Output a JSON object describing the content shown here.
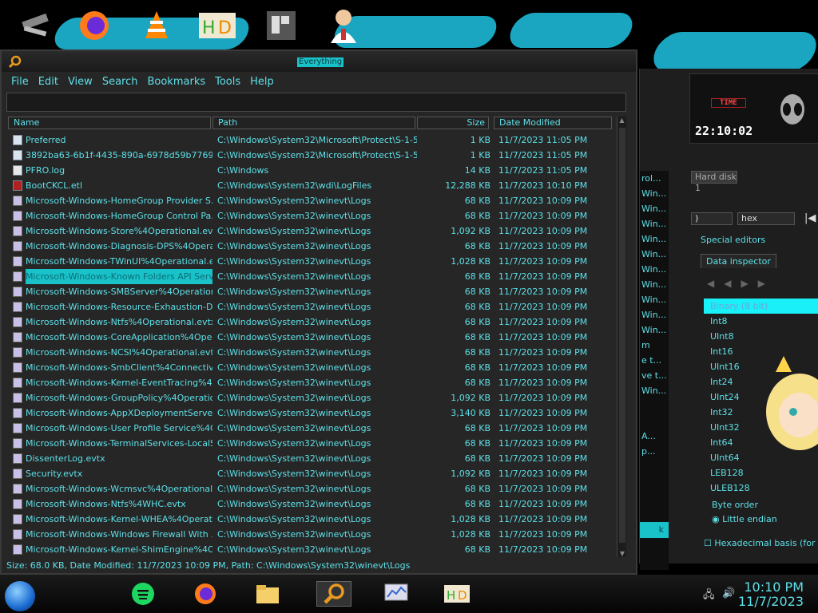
{
  "everything": {
    "title": "Everything",
    "menu": [
      "File",
      "Edit",
      "View",
      "Search",
      "Bookmarks",
      "Tools",
      "Help"
    ],
    "search_value": "",
    "columns": {
      "name": "Name",
      "path": "Path",
      "size": "Size",
      "date": "Date Modified"
    },
    "rows": [
      {
        "icon": "file",
        "name": "Preferred",
        "path": "C:\\Windows\\System32\\Microsoft\\Protect\\S-1-5-...",
        "size": "1 KB",
        "date": "11/7/2023 11:05 PM"
      },
      {
        "icon": "file",
        "name": "3892ba63-6b1f-4435-890a-6978d59b7769",
        "path": "C:\\Windows\\System32\\Microsoft\\Protect\\S-1-5-...",
        "size": "1 KB",
        "date": "11/7/2023 11:05 PM"
      },
      {
        "icon": "log",
        "name": "PFRO.log",
        "path": "C:\\Windows",
        "size": "14 KB",
        "date": "11/7/2023 11:05 PM"
      },
      {
        "icon": "etl",
        "name": "BootCKCL.etl",
        "path": "C:\\Windows\\System32\\wdi\\LogFiles",
        "size": "12,288 KB",
        "date": "11/7/2023 10:10 PM"
      },
      {
        "icon": "evtx",
        "name": "Microsoft-Windows-HomeGroup Provider S...",
        "path": "C:\\Windows\\System32\\winevt\\Logs",
        "size": "68 KB",
        "date": "11/7/2023 10:09 PM"
      },
      {
        "icon": "evtx",
        "name": "Microsoft-Windows-HomeGroup Control Pa...",
        "path": "C:\\Windows\\System32\\winevt\\Logs",
        "size": "68 KB",
        "date": "11/7/2023 10:09 PM"
      },
      {
        "icon": "evtx",
        "name": "Microsoft-Windows-Store%4Operational.evtx",
        "path": "C:\\Windows\\System32\\winevt\\Logs",
        "size": "1,092 KB",
        "date": "11/7/2023 10:09 PM"
      },
      {
        "icon": "evtx",
        "name": "Microsoft-Windows-Diagnosis-DPS%4Opera...",
        "path": "C:\\Windows\\System32\\winevt\\Logs",
        "size": "68 KB",
        "date": "11/7/2023 10:09 PM"
      },
      {
        "icon": "evtx",
        "name": "Microsoft-Windows-TWinUI%4Operational.e...",
        "path": "C:\\Windows\\System32\\winevt\\Logs",
        "size": "1,028 KB",
        "date": "11/7/2023 10:09 PM"
      },
      {
        "icon": "evtx",
        "name": "Microsoft-Windows-Known Folders API Serv...",
        "path": "C:\\Windows\\System32\\winevt\\Logs",
        "size": "68 KB",
        "date": "11/7/2023 10:09 PM",
        "selected": true
      },
      {
        "icon": "evtx",
        "name": "Microsoft-Windows-SMBServer%4Operation...",
        "path": "C:\\Windows\\System32\\winevt\\Logs",
        "size": "68 KB",
        "date": "11/7/2023 10:09 PM"
      },
      {
        "icon": "evtx",
        "name": "Microsoft-Windows-Resource-Exhaustion-D...",
        "path": "C:\\Windows\\System32\\winevt\\Logs",
        "size": "68 KB",
        "date": "11/7/2023 10:09 PM"
      },
      {
        "icon": "evtx",
        "name": "Microsoft-Windows-Ntfs%4Operational.evtx",
        "path": "C:\\Windows\\System32\\winevt\\Logs",
        "size": "68 KB",
        "date": "11/7/2023 10:09 PM"
      },
      {
        "icon": "evtx",
        "name": "Microsoft-Windows-CoreApplication%4Oper...",
        "path": "C:\\Windows\\System32\\winevt\\Logs",
        "size": "68 KB",
        "date": "11/7/2023 10:09 PM"
      },
      {
        "icon": "evtx",
        "name": "Microsoft-Windows-NCSI%4Operational.evtx",
        "path": "C:\\Windows\\System32\\winevt\\Logs",
        "size": "68 KB",
        "date": "11/7/2023 10:09 PM"
      },
      {
        "icon": "evtx",
        "name": "Microsoft-Windows-SmbClient%4Connectivit...",
        "path": "C:\\Windows\\System32\\winevt\\Logs",
        "size": "68 KB",
        "date": "11/7/2023 10:09 PM"
      },
      {
        "icon": "evtx",
        "name": "Microsoft-Windows-Kernel-EventTracing%4A...",
        "path": "C:\\Windows\\System32\\winevt\\Logs",
        "size": "68 KB",
        "date": "11/7/2023 10:09 PM"
      },
      {
        "icon": "evtx",
        "name": "Microsoft-Windows-GroupPolicy%4Operatio...",
        "path": "C:\\Windows\\System32\\winevt\\Logs",
        "size": "1,092 KB",
        "date": "11/7/2023 10:09 PM"
      },
      {
        "icon": "evtx",
        "name": "Microsoft-Windows-AppXDeploymentServe...",
        "path": "C:\\Windows\\System32\\winevt\\Logs",
        "size": "3,140 KB",
        "date": "11/7/2023 10:09 PM"
      },
      {
        "icon": "evtx",
        "name": "Microsoft-Windows-User Profile Service%4O...",
        "path": "C:\\Windows\\System32\\winevt\\Logs",
        "size": "68 KB",
        "date": "11/7/2023 10:09 PM"
      },
      {
        "icon": "evtx",
        "name": "Microsoft-Windows-TerminalServices-LocalS...",
        "path": "C:\\Windows\\System32\\winevt\\Logs",
        "size": "68 KB",
        "date": "11/7/2023 10:09 PM"
      },
      {
        "icon": "evtx",
        "name": "DissenterLog.evtx",
        "path": "C:\\Windows\\System32\\winevt\\Logs",
        "size": "68 KB",
        "date": "11/7/2023 10:09 PM"
      },
      {
        "icon": "evtx",
        "name": "Security.evtx",
        "path": "C:\\Windows\\System32\\winevt\\Logs",
        "size": "1,092 KB",
        "date": "11/7/2023 10:09 PM"
      },
      {
        "icon": "evtx",
        "name": "Microsoft-Windows-Wcmsvc%4Operational....",
        "path": "C:\\Windows\\System32\\winevt\\Logs",
        "size": "68 KB",
        "date": "11/7/2023 10:09 PM"
      },
      {
        "icon": "evtx",
        "name": "Microsoft-Windows-Ntfs%4WHC.evtx",
        "path": "C:\\Windows\\System32\\winevt\\Logs",
        "size": "68 KB",
        "date": "11/7/2023 10:09 PM"
      },
      {
        "icon": "evtx",
        "name": "Microsoft-Windows-Kernel-WHEA%4Operati...",
        "path": "C:\\Windows\\System32\\winevt\\Logs",
        "size": "1,028 KB",
        "date": "11/7/2023 10:09 PM"
      },
      {
        "icon": "evtx",
        "name": "Microsoft-Windows-Windows Firewall With ...",
        "path": "C:\\Windows\\System32\\winevt\\Logs",
        "size": "1,028 KB",
        "date": "11/7/2023 10:09 PM"
      },
      {
        "icon": "evtx",
        "name": "Microsoft-Windows-Kernel-ShimEngine%4O...",
        "path": "C:\\Windows\\System32\\winevt\\Logs",
        "size": "68 KB",
        "date": "11/7/2023 10:09 PM"
      }
    ],
    "status": "Size: 68.0 KB, Date Modified: 11/7/2023 10:09 PM, Path: C:\\Windows\\System32\\winevt\\Logs"
  },
  "hxd": {
    "clock_label": "TIME",
    "clock_time": "22:10:02",
    "hard_disk": "Hard disk 1",
    "format_left": ")",
    "format_select": "hex",
    "special_editors": "Special editors",
    "data_inspector": "Data inspector",
    "inspector_rows": [
      "Binary (8 bit)",
      "Int8",
      "UInt8",
      "Int16",
      "UInt16",
      "Int24",
      "UInt24",
      "Int32",
      "UInt32",
      "Int64",
      "UInt64",
      "LEB128",
      "ULEB128"
    ],
    "byte_order": "Byte order",
    "little_endian": "Little endian",
    "hex_basis": "Hexadecimal basis (for inte",
    "left_col": [
      "rol...",
      "Win...",
      "Win...",
      "Win...",
      "Win...",
      "Win...",
      "Win...",
      "Win...",
      "Win...",
      "Win...",
      "Win...",
      "m",
      "e t...",
      "ve t...",
      "Win...",
      "",
      "",
      "A...",
      "p..."
    ],
    "button_partial": "k"
  },
  "taskbar": {
    "time": "10:10 PM",
    "date": "11/7/2023"
  },
  "colors": {
    "accent": "#19c2c9",
    "text": "#5ee0e8",
    "window": "#262626"
  }
}
